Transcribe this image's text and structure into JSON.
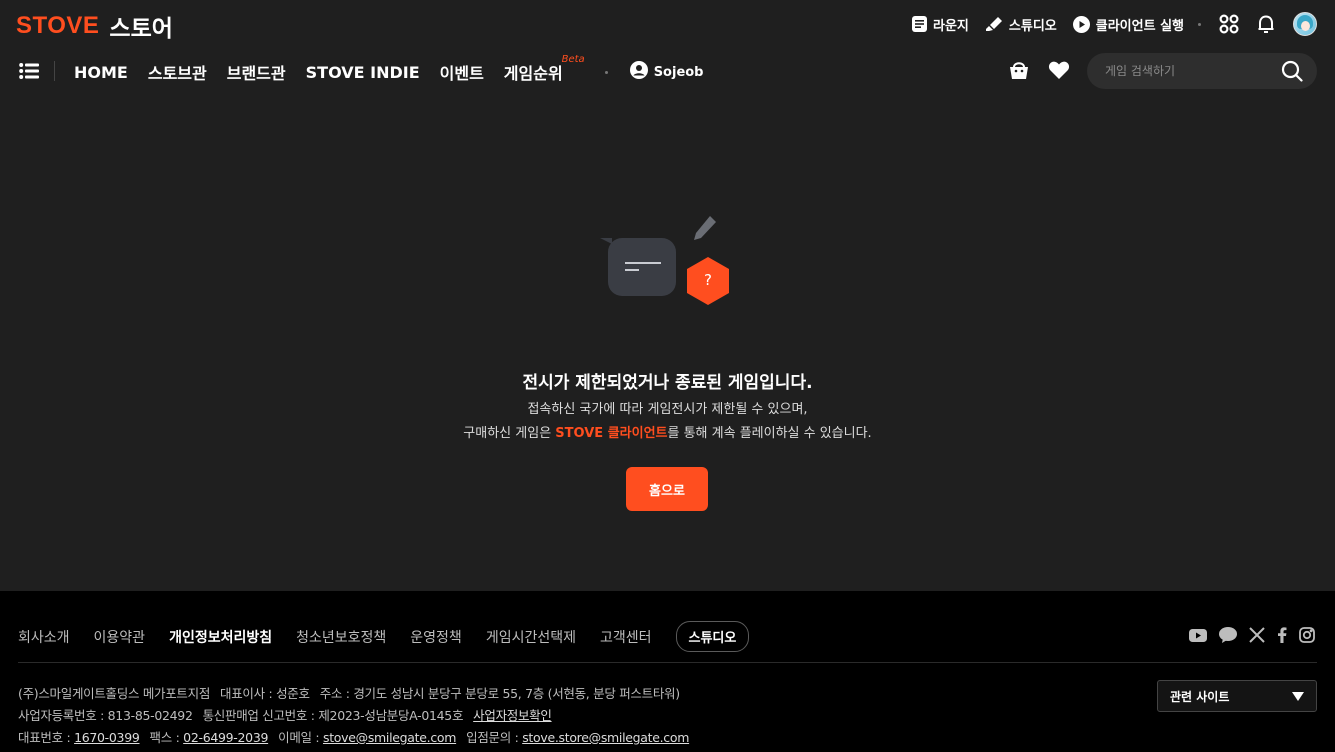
{
  "header": {
    "logo": "STOVE",
    "store": "스토어",
    "util": [
      {
        "label": "라운지",
        "icon": "lounge-icon"
      },
      {
        "label": "스튜디오",
        "icon": "studio-icon"
      },
      {
        "label": "클라이언트 실행",
        "icon": "play-icon"
      }
    ]
  },
  "nav": {
    "items": [
      "HOME",
      "스토브관",
      "브랜드관",
      "STOVE INDIE",
      "이벤트",
      "게임순위"
    ],
    "beta": "Beta",
    "user": "Sojeob",
    "search_placeholder": "게임 검색하기"
  },
  "message": {
    "title": "전시가 제한되었거나 종료된 게임입니다.",
    "line1": "접속하신 국가에 따라 게임전시가 제한될 수 있으며,",
    "line2_pre": "구매하신 게임은 ",
    "line2_accent": "STOVE 클라이언트",
    "line2_post": "를 통해 계속 플레이하실 수 있습니다.",
    "button": "홈으로",
    "badge": "?"
  },
  "footer": {
    "links": [
      "회사소개",
      "이용약관",
      "개인정보처리방침",
      "청소년보호정책",
      "운영정책",
      "게임시간선택제",
      "고객센터"
    ],
    "studio": "스튜디오",
    "company": "(주)스마일게이트홀딩스 메가포트지점",
    "ceo": "대표이사 : 성준호",
    "address": "주소 : 경기도 성남시 분당구 분당로 55, 7층 (서현동, 분당 퍼스트타워)",
    "biz_no": "사업자등록번호 : 813-85-02492",
    "mail_order": "통신판매업 신고번호 : 제2023-성남분당A-0145호",
    "biz_info": "사업자정보확인",
    "tel_label": "대표번호 : ",
    "tel": "1670-0399",
    "fax_label": "팩스 : ",
    "fax": "02-6499-2039",
    "email_label": "이메일 : ",
    "email": "stove@smilegate.com",
    "store_label": "입점문의 : ",
    "store_email": "stove.store@smilegate.com",
    "related": "관련 사이트"
  },
  "colors": {
    "accent": "#ff4e1f",
    "background": "#1f1f1f",
    "footer": "#000000"
  }
}
